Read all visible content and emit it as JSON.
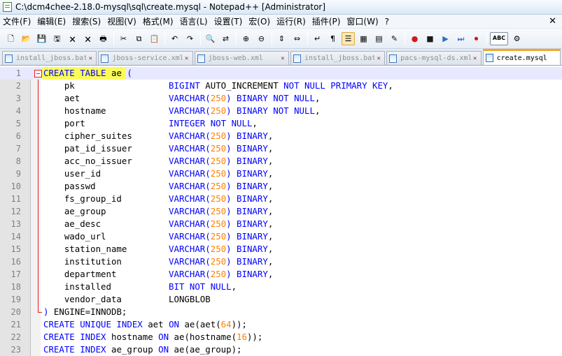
{
  "window": {
    "title": "C:\\dcm4chee-2.18.0-mysql\\sql\\create.mysql - Notepad++ [Administrator]"
  },
  "menu": {
    "items": [
      "文件(F)",
      "编辑(E)",
      "搜索(S)",
      "视图(V)",
      "格式(M)",
      "语言(L)",
      "设置(T)",
      "宏(O)",
      "运行(R)",
      "插件(P)",
      "窗口(W)",
      "?"
    ],
    "close_glyph": "✕"
  },
  "toolbar": {
    "buttons": [
      {
        "icon": "new-file-icon",
        "glyph": "🗋"
      },
      {
        "icon": "open-file-icon",
        "glyph": "📂"
      },
      {
        "icon": "save-icon",
        "glyph": "💾"
      },
      {
        "icon": "save-all-icon",
        "glyph": "🖫"
      },
      {
        "icon": "close-icon",
        "glyph": "🗙"
      },
      {
        "icon": "close-all-icon",
        "glyph": "🗙"
      },
      {
        "icon": "print-icon",
        "glyph": "🖶"
      },
      {
        "icon": "cut-icon",
        "glyph": "✂"
      },
      {
        "icon": "copy-icon",
        "glyph": "⧉"
      },
      {
        "icon": "paste-icon",
        "glyph": "📋"
      },
      {
        "icon": "undo-icon",
        "glyph": "↶"
      },
      {
        "icon": "redo-icon",
        "glyph": "↷"
      },
      {
        "icon": "find-icon",
        "glyph": "🔍"
      },
      {
        "icon": "replace-icon",
        "glyph": "⇄"
      },
      {
        "icon": "zoom-in-icon",
        "glyph": "⊕"
      },
      {
        "icon": "zoom-out-icon",
        "glyph": "⊖"
      },
      {
        "icon": "sync-vertical-icon",
        "glyph": "⇕"
      },
      {
        "icon": "sync-horizontal-icon",
        "glyph": "⇔"
      },
      {
        "icon": "word-wrap-icon",
        "glyph": "↵"
      },
      {
        "icon": "show-all-chars-icon",
        "glyph": "¶"
      },
      {
        "icon": "indent-guide-icon",
        "glyph": "☰"
      },
      {
        "icon": "user-lang-icon",
        "glyph": "▦"
      },
      {
        "icon": "function-list-icon",
        "glyph": "▤"
      },
      {
        "icon": "folder-workspace-icon",
        "glyph": "✎"
      },
      {
        "icon": "record-macro-icon",
        "glyph": "●"
      },
      {
        "icon": "stop-macro-icon",
        "glyph": "■"
      },
      {
        "icon": "play-macro-icon",
        "glyph": "▶"
      },
      {
        "icon": "play-multiple-icon",
        "glyph": "⏭"
      },
      {
        "icon": "save-macro-icon",
        "glyph": "⏺"
      },
      {
        "icon": "spell-check-icon",
        "glyph": "ABC"
      },
      {
        "icon": "plugin-icon",
        "glyph": "⚙"
      }
    ],
    "colors": {
      "record": "#d11a1a",
      "play": "#2f6fc2",
      "stop": "#1a1a1a"
    }
  },
  "tabs": [
    {
      "label": "install_jboss.bat",
      "active": false
    },
    {
      "label": "jboss-service.xml",
      "active": false
    },
    {
      "label": "jboss-web.xml",
      "active": false
    },
    {
      "label": "install_jboss.bat",
      "active": false
    },
    {
      "label": "pacs-mysql-ds.xml",
      "active": false
    },
    {
      "label": "create.mysql",
      "active": true
    }
  ],
  "editor": {
    "colors": {
      "keyword": "#0000ff",
      "number": "#ff8000",
      "text": "#000000",
      "line_number": "#808080"
    },
    "lines": [
      {
        "n": "1",
        "tokens": [
          [
            "kw",
            "CREATE TABLE"
          ],
          [
            "pl",
            " ae "
          ],
          [
            "kw",
            "("
          ]
        ]
      },
      {
        "n": "2",
        "tokens": [
          [
            "pl",
            "    pk                  "
          ],
          [
            "kw",
            "BIGINT"
          ],
          [
            "pl",
            " AUTO_INCREMENT "
          ],
          [
            "kw",
            "NOT NULL PRIMARY KEY"
          ],
          [
            "pl",
            ","
          ]
        ]
      },
      {
        "n": "3",
        "tokens": [
          [
            "pl",
            "    aet                 "
          ],
          [
            "kw",
            "VARCHAR("
          ],
          [
            "num",
            "250"
          ],
          [
            "kw",
            ") BINARY NOT NULL"
          ],
          [
            "pl",
            ","
          ]
        ]
      },
      {
        "n": "4",
        "tokens": [
          [
            "pl",
            "    hostname            "
          ],
          [
            "kw",
            "VARCHAR("
          ],
          [
            "num",
            "250"
          ],
          [
            "kw",
            ") BINARY NOT NULL"
          ],
          [
            "pl",
            ","
          ]
        ]
      },
      {
        "n": "5",
        "tokens": [
          [
            "pl",
            "    port                "
          ],
          [
            "kw",
            "INTEGER NOT NULL"
          ],
          [
            "pl",
            ","
          ]
        ]
      },
      {
        "n": "6",
        "tokens": [
          [
            "pl",
            "    cipher_suites       "
          ],
          [
            "kw",
            "VARCHAR("
          ],
          [
            "num",
            "250"
          ],
          [
            "kw",
            ") BINARY"
          ],
          [
            "pl",
            ","
          ]
        ]
      },
      {
        "n": "7",
        "tokens": [
          [
            "pl",
            "    pat_id_issuer       "
          ],
          [
            "kw",
            "VARCHAR("
          ],
          [
            "num",
            "250"
          ],
          [
            "kw",
            ") BINARY"
          ],
          [
            "pl",
            ","
          ]
        ]
      },
      {
        "n": "8",
        "tokens": [
          [
            "pl",
            "    acc_no_issuer       "
          ],
          [
            "kw",
            "VARCHAR("
          ],
          [
            "num",
            "250"
          ],
          [
            "kw",
            ") BINARY"
          ],
          [
            "pl",
            ","
          ]
        ]
      },
      {
        "n": "9",
        "tokens": [
          [
            "pl",
            "    user_id             "
          ],
          [
            "kw",
            "VARCHAR("
          ],
          [
            "num",
            "250"
          ],
          [
            "kw",
            ") BINARY"
          ],
          [
            "pl",
            ","
          ]
        ]
      },
      {
        "n": "10",
        "tokens": [
          [
            "pl",
            "    passwd              "
          ],
          [
            "kw",
            "VARCHAR("
          ],
          [
            "num",
            "250"
          ],
          [
            "kw",
            ") BINARY"
          ],
          [
            "pl",
            ","
          ]
        ]
      },
      {
        "n": "11",
        "tokens": [
          [
            "pl",
            "    fs_group_id         "
          ],
          [
            "kw",
            "VARCHAR("
          ],
          [
            "num",
            "250"
          ],
          [
            "kw",
            ") BINARY"
          ],
          [
            "pl",
            ","
          ]
        ]
      },
      {
        "n": "12",
        "tokens": [
          [
            "pl",
            "    ae_group            "
          ],
          [
            "kw",
            "VARCHAR("
          ],
          [
            "num",
            "250"
          ],
          [
            "kw",
            ") BINARY"
          ],
          [
            "pl",
            ","
          ]
        ]
      },
      {
        "n": "13",
        "tokens": [
          [
            "pl",
            "    ae_desc             "
          ],
          [
            "kw",
            "VARCHAR("
          ],
          [
            "num",
            "250"
          ],
          [
            "kw",
            ") BINARY"
          ],
          [
            "pl",
            ","
          ]
        ]
      },
      {
        "n": "14",
        "tokens": [
          [
            "pl",
            "    wado_url            "
          ],
          [
            "kw",
            "VARCHAR("
          ],
          [
            "num",
            "250"
          ],
          [
            "kw",
            ") BINARY"
          ],
          [
            "pl",
            ","
          ]
        ]
      },
      {
        "n": "15",
        "tokens": [
          [
            "pl",
            "    station_name        "
          ],
          [
            "kw",
            "VARCHAR("
          ],
          [
            "num",
            "250"
          ],
          [
            "kw",
            ") BINARY"
          ],
          [
            "pl",
            ","
          ]
        ]
      },
      {
        "n": "16",
        "tokens": [
          [
            "pl",
            "    institution         "
          ],
          [
            "kw",
            "VARCHAR("
          ],
          [
            "num",
            "250"
          ],
          [
            "kw",
            ") BINARY"
          ],
          [
            "pl",
            ","
          ]
        ]
      },
      {
        "n": "17",
        "tokens": [
          [
            "pl",
            "    department          "
          ],
          [
            "kw",
            "VARCHAR("
          ],
          [
            "num",
            "250"
          ],
          [
            "kw",
            ") BINARY"
          ],
          [
            "pl",
            ","
          ]
        ]
      },
      {
        "n": "18",
        "tokens": [
          [
            "pl",
            "    installed           "
          ],
          [
            "kw",
            "BIT NOT NULL"
          ],
          [
            "pl",
            ","
          ]
        ]
      },
      {
        "n": "19",
        "tokens": [
          [
            "pl",
            "    vendor_data         "
          ],
          [
            "pl",
            "LONGBLOB"
          ]
        ]
      },
      {
        "n": "20",
        "tokens": [
          [
            "kw",
            ")"
          ],
          [
            "pl",
            " ENGINE=INNODB;"
          ]
        ]
      },
      {
        "n": "21",
        "tokens": [
          [
            "kw",
            "CREATE UNIQUE INDEX"
          ],
          [
            "pl",
            " aet "
          ],
          [
            "kw",
            "ON"
          ],
          [
            "pl",
            " ae(aet("
          ],
          [
            "num",
            "64"
          ],
          [
            "pl",
            "));"
          ]
        ]
      },
      {
        "n": "22",
        "tokens": [
          [
            "kw",
            "CREATE INDEX"
          ],
          [
            "pl",
            " hostname "
          ],
          [
            "kw",
            "ON"
          ],
          [
            "pl",
            " ae(hostname("
          ],
          [
            "num",
            "16"
          ],
          [
            "pl",
            "));"
          ]
        ]
      },
      {
        "n": "23",
        "tokens": [
          [
            "kw",
            "CREATE INDEX"
          ],
          [
            "pl",
            " ae_group "
          ],
          [
            "kw",
            "ON"
          ],
          [
            "pl",
            " ae(ae_group);"
          ]
        ]
      }
    ]
  }
}
